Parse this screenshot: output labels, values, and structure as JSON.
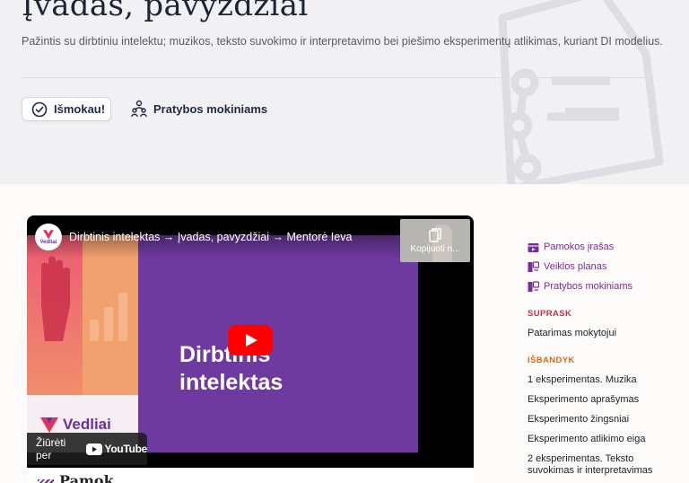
{
  "header": {
    "title": "Įvadas, pavyzdžiai",
    "subtitle": "Pažintis su dirbtiniu intelektu; muzikos, teksto suvokimo ir interpretavimo bei piešimo eksperimentų atlikimas, kuriant DI modelius.",
    "learned_button": "Išmokau!",
    "practice_link": "Pratybos mokiniams"
  },
  "video": {
    "channel_logo": "Vedliai",
    "title": "Dirbtinis intelektas → Įvadas, pavyzdžiai → Mentorė Ieva",
    "copy_label": "Kopijuoti n...",
    "headline_line1": "Dirbtinis",
    "headline_line2": "intelektas",
    "brand": "Vedliai",
    "watch_label": "Žiūrėti per",
    "youtube_label": "YouTube"
  },
  "below_video": {
    "title": "Pamok"
  },
  "sidebar": {
    "links": [
      {
        "label": "Pamokos įrašas",
        "icon": "video-icon"
      },
      {
        "label": "Veiklos planas",
        "icon": "plan-icon"
      },
      {
        "label": "Pratybos mokiniams",
        "icon": "exercise-icon"
      }
    ],
    "section_suprask": "SUPRASK",
    "suprask_items": [
      "Patarimas mokytojui"
    ],
    "section_isbandyk": "IŠBANDYK",
    "isbandyk_items": [
      "1 eksperimentas. Muzika",
      "Eksperimento aprašymas",
      "Eksperimento žingsniai",
      "Eksperimento atlikimo eiga",
      "2 eksperimentas. Teksto suvokimas ir interpretavimas"
    ]
  },
  "colors": {
    "accent_purple": "#7a2d96",
    "suprask_red": "#c0324d",
    "isbandyk_orange": "#d86a1a",
    "youtube_red": "#ff0000"
  }
}
